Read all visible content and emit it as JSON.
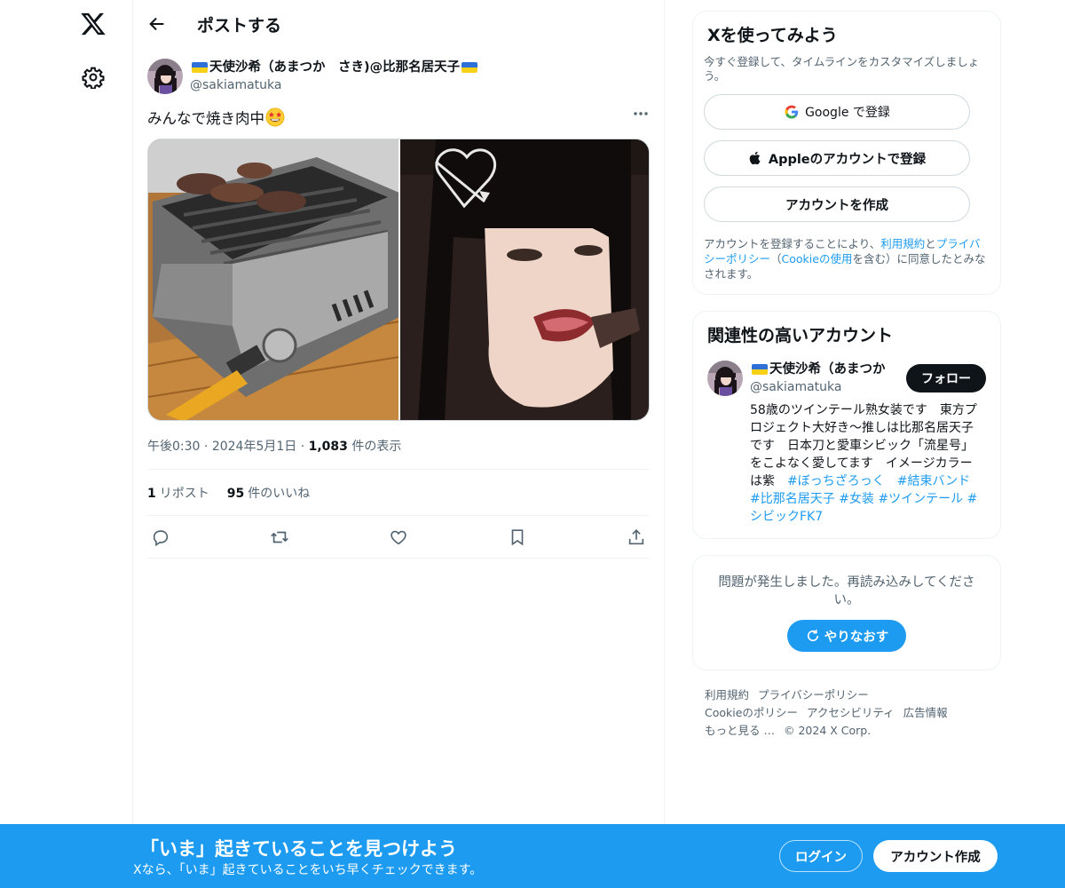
{
  "header": {
    "title": "ポストする"
  },
  "post": {
    "author_name": "天使沙希（あまつか　さき)@比那名居天子",
    "handle": "@sakiamatuka",
    "text": "みんなで焼き肉中",
    "time": "午後0:30",
    "date": "2024年5月1日",
    "views_count": "1,083",
    "views_label": "件の表示",
    "reposts_count": "1",
    "reposts_label": "リポスト",
    "likes_count": "95",
    "likes_label": "件のいいね"
  },
  "signup": {
    "title": "Xを使ってみよう",
    "subtitle": "今すぐ登録して、タイムラインをカスタマイズしましょう。",
    "google": "Google で登録",
    "apple": "Appleのアカウントで登録",
    "create": "アカウントを作成",
    "terms_prefix": "アカウントを登録することにより、",
    "terms_link": "利用規約",
    "terms_and": "と",
    "privacy_link": "プライバシーポリシー",
    "terms_open": "（",
    "cookie_link": "Cookieの使用",
    "terms_suffix": "を含む）に同意したとみなされます。"
  },
  "related": {
    "title": "関連性の高いアカウント",
    "name": "天使沙希（あまつか",
    "handle": "@sakiamatuka",
    "follow": "フォロー",
    "bio_text": "58歳のツインテール熟女装です　東方プロジェクト大好き〜推しは比那名居天子です　日本刀と愛車シビック「流星号」をこよなく愛してます　イメージカラーは紫　",
    "tags": [
      "#ぼっちざろっく",
      "#結束バンド",
      "#比那名居天子",
      "#女装",
      "#ツインテール",
      "#シビックFK7"
    ]
  },
  "error": {
    "message": "問題が発生しました。再読み込みしてください。",
    "retry": "やりなおす"
  },
  "footer": {
    "links": [
      "利用規約",
      "プライバシーポリシー",
      "Cookieのポリシー",
      "アクセシビリティ",
      "広告情報",
      "もっと見る …"
    ],
    "copyright": "© 2024 X Corp."
  },
  "banner": {
    "title": "「いま」起きていることを見つけよう",
    "subtitle": "Xなら、「いま」起きていることをいち早くチェックできます。",
    "login": "ログイン",
    "signup": "アカウント作成"
  },
  "colors": {
    "accent": "#1d9bf0",
    "text": "#0f1419",
    "muted": "#536471"
  }
}
